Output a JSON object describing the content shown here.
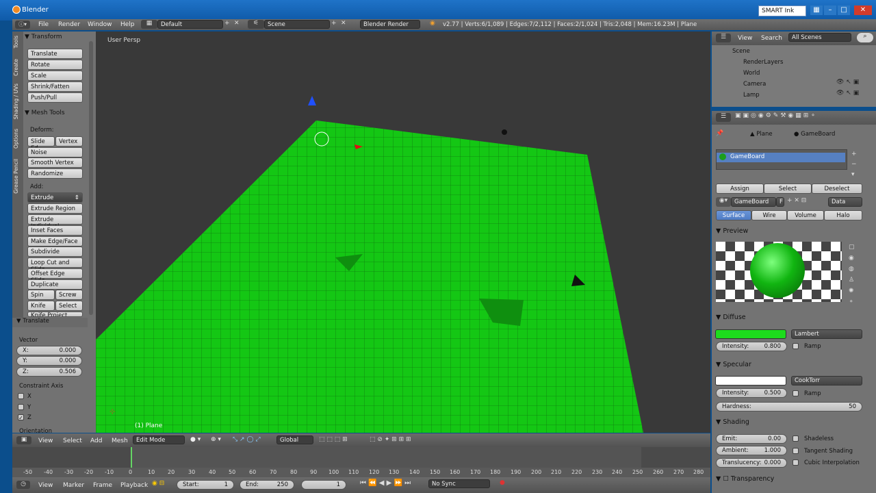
{
  "window": {
    "title": "Blender",
    "smartink": "SMART Ink"
  },
  "infobar": {
    "menus": [
      "File",
      "Render",
      "Window",
      "Help"
    ],
    "layout": "Default",
    "scene": "Scene",
    "engine": "Blender Render",
    "stats": "v2.77 | Verts:6/1,089 | Edges:7/2,112 | Faces:2/1,024 | Tris:2,048 | Mem:16.23M | Plane"
  },
  "toolshelf": {
    "tabs": [
      "Tools",
      "Create",
      "Shading / UVs",
      "Options",
      "Grease Pencil"
    ],
    "transform_title": "Transform",
    "transform_buttons": [
      "Translate",
      "Rotate",
      "Scale",
      "Shrink/Fatten",
      "Push/Pull"
    ],
    "meshtools_title": "Mesh Tools",
    "deform_label": "Deform:",
    "slide_edge": "Slide Ed",
    "vertex": "Vertex",
    "noise": "Noise",
    "smooth_vertex": "Smooth Vertex",
    "randomize": "Randomize",
    "add_label": "Add:",
    "extrude": "Extrude",
    "add_buttons": [
      "Extrude Region",
      "Extrude Individual",
      "Inset Faces",
      "Make Edge/Face",
      "Subdivide",
      "Loop Cut and Slide",
      "Offset Edge Slide",
      "Duplicate"
    ],
    "spin": "Spin",
    "screw": "Screw",
    "knife": "Knife",
    "select": "Select",
    "knife_project": "Knife Project",
    "operator_title": "Translate",
    "vector_label": "Vector",
    "x": "X:",
    "x_val": "0.000",
    "y": "Y:",
    "y_val": "0.000",
    "z": "Z:",
    "z_val": "0.506",
    "constraint_label": "Constraint Axis",
    "cx": "X",
    "cy": "Y",
    "cz": "Z",
    "orientation": "Orientation"
  },
  "viewport": {
    "label": "User Persp",
    "object": "(1) Plane"
  },
  "vpheader": {
    "menus": [
      "View",
      "Select",
      "Add",
      "Mesh"
    ],
    "mode": "Edit Mode",
    "orientation": "Global"
  },
  "timeline": {
    "ticks": [
      "-50",
      "-40",
      "-30",
      "-20",
      "-10",
      "0",
      "10",
      "20",
      "30",
      "40",
      "50",
      "60",
      "70",
      "80",
      "90",
      "100",
      "110",
      "120",
      "130",
      "140",
      "150",
      "160",
      "170",
      "180",
      "190",
      "200",
      "210",
      "220",
      "230",
      "240",
      "250",
      "260",
      "270",
      "280"
    ],
    "menus": [
      "View",
      "Marker",
      "Frame",
      "Playback"
    ],
    "start_label": "Start:",
    "start": "1",
    "end_label": "End:",
    "end": "250",
    "current": "1",
    "sync": "No Sync"
  },
  "outliner": {
    "view": "View",
    "search": "Search",
    "filter": "All Scenes",
    "items": [
      "Scene",
      "RenderLayers",
      "World",
      "Camera",
      "Lamp"
    ]
  },
  "props": {
    "breadcrumb_plane": "Plane",
    "breadcrumb_mat": "GameBoard",
    "slot": "GameBoard",
    "assign": "Assign",
    "select": "Select",
    "deselect": "Deselect",
    "material_name": "GameBoard",
    "fake": "F",
    "data": "Data",
    "tabs": [
      "Surface",
      "Wire",
      "Volume",
      "Halo"
    ],
    "preview": "Preview",
    "diffuse": "Diffuse",
    "diffuse_shader": "Lambert",
    "diffuse_int_label": "Intensity:",
    "diffuse_int": "0.800",
    "ramp": "Ramp",
    "diffuse_color": "#1ddc1d",
    "specular": "Specular",
    "spec_shader": "CookTorr",
    "spec_int_label": "Intensity:",
    "spec_int": "0.500",
    "hardness_label": "Hardness:",
    "hardness": "50",
    "shading": "Shading",
    "emit_label": "Emit:",
    "emit": "0.00",
    "ambient_label": "Ambient:",
    "ambient": "1.000",
    "transl_label": "Translucency:",
    "transl": "0.000",
    "shadeless": "Shadeless",
    "tangent": "Tangent Shading",
    "cubic": "Cubic Interpolation",
    "transparency": "Transparency"
  }
}
